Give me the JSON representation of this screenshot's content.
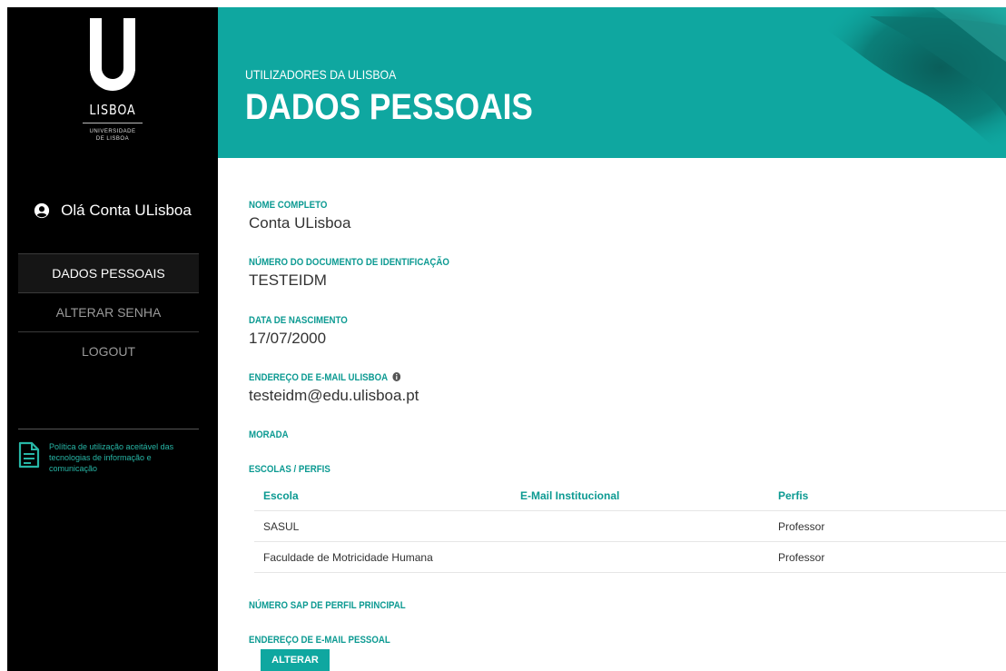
{
  "sidebar": {
    "logo": {
      "letter": "U",
      "name": "LISBOA",
      "sub_line1": "UNIVERSIDADE",
      "sub_line2": "DE LISBOA"
    },
    "greeting": "Olá Conta ULisboa",
    "nav": [
      {
        "label": "DADOS PESSOAIS",
        "active": true
      },
      {
        "label": "ALTERAR SENHA",
        "active": false
      },
      {
        "label": "LOGOUT",
        "active": false
      }
    ],
    "policy_link": "Política de utilização aceitável das tecnologias de informação e comunicação"
  },
  "banner": {
    "kicker": "UTILIZADORES DA ULISBOA",
    "title": "DADOS PESSOAIS"
  },
  "fields": {
    "nome_label": "NOME COMPLETO",
    "nome_value": "Conta ULisboa",
    "doc_label": "NÚMERO DO DOCUMENTO DE IDENTIFICAÇÃO",
    "doc_value": "TESTEIDM",
    "nasc_label": "DATA DE NASCIMENTO",
    "nasc_value": "17/07/2000",
    "email_label": "ENDEREÇO DE E-MAIL ULISBOA",
    "email_value": "testeidm@edu.ulisboa.pt",
    "morada_label": "MORADA",
    "escolas_label": "ESCOLAS / PERFIS",
    "sap_label": "NÚMERO SAP DE PERFIL PRINCIPAL",
    "email_pessoal_label": "ENDEREÇO DE E-MAIL PESSOAL"
  },
  "table": {
    "headers": [
      "Escola",
      "E-Mail Institucional",
      "Perfis"
    ],
    "rows": [
      [
        "SASUL",
        "",
        "Professor"
      ],
      [
        "Faculdade de Motricidade Humana",
        "",
        "Professor"
      ]
    ]
  },
  "buttons": {
    "alterar": "ALTERAR"
  },
  "colors": {
    "accent": "#0fa7a0",
    "sidebar_bg": "#000000",
    "label": "#0c9a92"
  },
  "icons": {
    "user": "user-circle-icon",
    "info": "info-icon",
    "document": "document-icon"
  }
}
